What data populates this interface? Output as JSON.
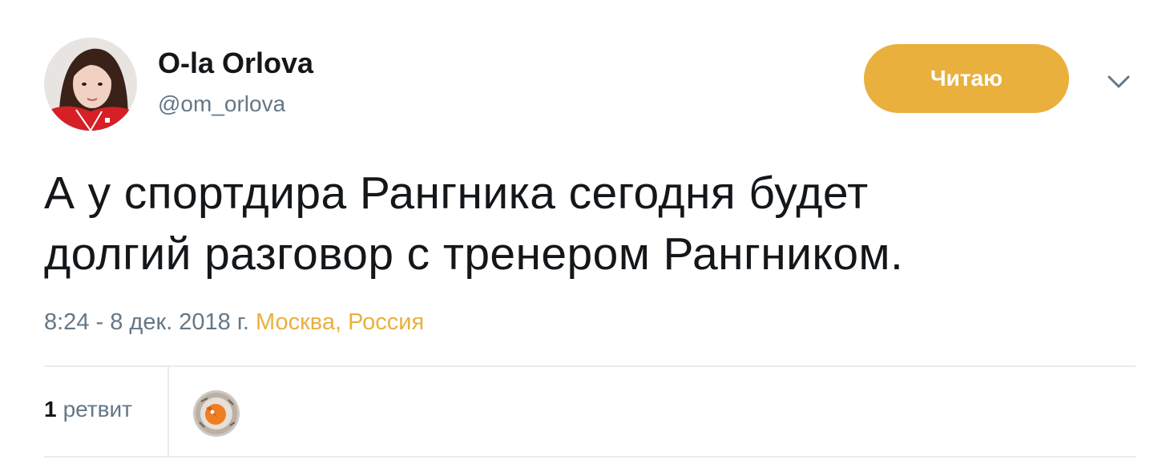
{
  "user": {
    "display_name": "O-la Orlova",
    "handle": "@om_orlova"
  },
  "follow_button": {
    "label": "Читаю",
    "color": "#e9b03e"
  },
  "tweet": {
    "text_lines": [
      "А у спортдира Рангника сегодня будет",
      "долгий разговор с тренером Рангником."
    ],
    "timestamp": "8:24 - 8 дек. 2018 г.",
    "location": "Москва, Россия"
  },
  "stats": {
    "retweet_count": "1",
    "retweet_label": "ретвит"
  },
  "icons": {
    "caret": "chevron-down-icon"
  },
  "colors": {
    "text": "#14171a",
    "muted": "#657786",
    "accent": "#e9b03e",
    "divider": "#e6ecf0"
  }
}
